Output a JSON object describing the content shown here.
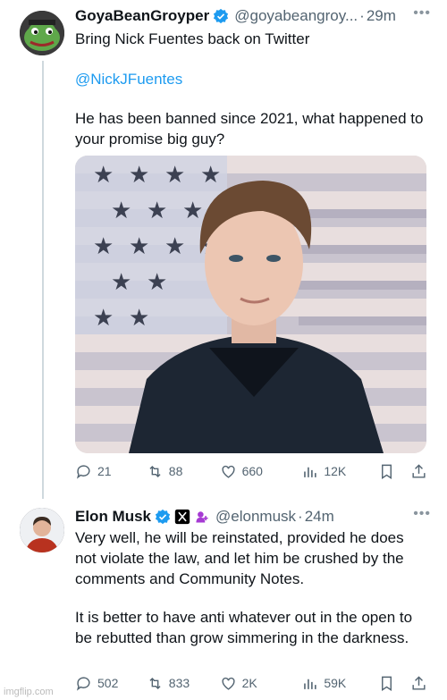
{
  "tweet1": {
    "name": "GoyaBeanGroyper",
    "handle": "@goyabeangroy...",
    "time": "29m",
    "text_line1": "Bring Nick Fuentes back on Twitter",
    "mention": "@NickJFuentes",
    "text_line2": "He has been banned since 2021, what happened to your promise big guy?",
    "stats": {
      "replies": "21",
      "reposts": "88",
      "likes": "660",
      "views": "12K"
    }
  },
  "tweet2": {
    "name": "Elon Musk",
    "handle": "@elonmusk",
    "time": "24m",
    "text_para1": "Very well, he will be reinstated, provided he does not violate the law, and let him be crushed by the comments and Community Notes.",
    "text_para2": "It is better to have anti whatever out in the open to be rebutted than grow simmering in the darkness.",
    "stats": {
      "replies": "502",
      "reposts": "833",
      "likes": "2K",
      "views": "59K"
    }
  },
  "watermark": "imgflip.com",
  "colors": {
    "accent": "#1d9bf0",
    "muted": "#536471",
    "line": "#cfd9de"
  }
}
